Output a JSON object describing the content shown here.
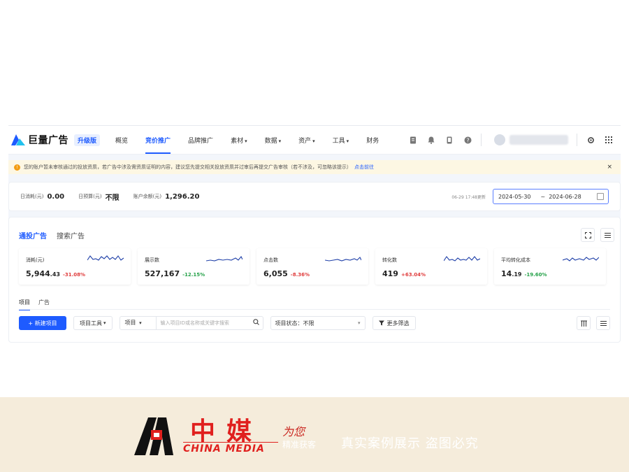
{
  "brand": {
    "name": "巨量广告",
    "badge": "升级版"
  },
  "nav": {
    "items": [
      {
        "label": "概览"
      },
      {
        "label": "竞价推广",
        "active": true
      },
      {
        "label": "品牌推广"
      },
      {
        "label": "素材"
      },
      {
        "label": "数据"
      },
      {
        "label": "资产"
      },
      {
        "label": "工具"
      },
      {
        "label": "财务"
      }
    ],
    "icons": [
      "document-icon",
      "bell-icon",
      "phone-icon",
      "help-icon",
      "settings-icon",
      "grid-icon"
    ]
  },
  "notice": {
    "text": "您的账户暂未审核通过的投放资质，若广告中涉及需资质证明的内容，建议您先提交相关投放资质并过审后再提交广告审核（若不涉及，可忽略该提示）",
    "link": "点击前往",
    "close": "×"
  },
  "budget": {
    "daily_spend_label": "日消耗(元)",
    "daily_spend": "0.00",
    "daily_budget_label": "日预算(元)",
    "daily_budget": "不限",
    "balance_label": "账户余额(元)",
    "balance": "1,296.20",
    "update_time": "06-29 17:48更新",
    "date_start": "2024-05-30",
    "date_end": "2024-06-28",
    "tilde": "~"
  },
  "panel": {
    "tabs": [
      {
        "label": "通投广告",
        "active": true
      },
      {
        "label": "搜索广告"
      }
    ],
    "metrics": [
      {
        "label": "消耗(元)",
        "value_main": "5,944",
        "value_small": ".43",
        "change": "-31.08%",
        "dir": "down"
      },
      {
        "label": "展示数",
        "value_main": "527,167",
        "value_small": "",
        "change": "-12.15%",
        "dir": "up"
      },
      {
        "label": "点击数",
        "value_main": "6,055",
        "value_small": "",
        "change": "-8.36%",
        "dir": "down"
      },
      {
        "label": "转化数",
        "value_main": "419",
        "value_small": "",
        "change": "+63.04%",
        "dir": "down"
      },
      {
        "label": "平均转化成本",
        "value_main": "14",
        "value_small": ".19",
        "change": "-19.60%",
        "dir": "up"
      }
    ],
    "sub_tabs": [
      {
        "label": "项目",
        "active": true
      },
      {
        "label": "广告"
      }
    ],
    "toolbar": {
      "new_project": "+ 新建项目",
      "project_tools": "项目工具",
      "search_scope": "项目",
      "search_placeholder": "输入项目ID或名称或关键字搜索",
      "status_label": "项目状态：",
      "status_value": "不限",
      "more_filters": "更多筛选"
    }
  },
  "watermark": {
    "cn": "中媒",
    "en": "CHINA MEDIA",
    "slogan1": "为您",
    "slogan2": "精准获客",
    "tagline": "真实案例展示  盗图必究"
  },
  "colors": {
    "accent": "#1e5bff",
    "down": "#e03d3d",
    "up": "#24a148",
    "watermark_red": "#e0201e"
  }
}
